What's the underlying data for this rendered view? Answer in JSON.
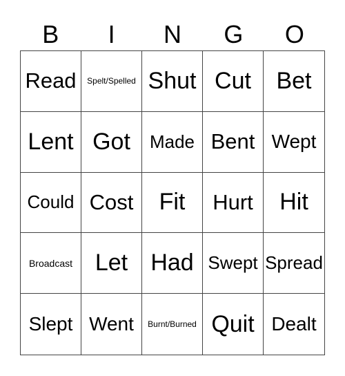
{
  "header": {
    "letters": [
      "B",
      "I",
      "N",
      "G",
      "O"
    ]
  },
  "board": {
    "rows": [
      [
        "Read",
        "Spelt/Spelled",
        "Shut",
        "Cut",
        "Bet"
      ],
      [
        "Lent",
        "Got",
        "Made",
        "Bent",
        "Wept"
      ],
      [
        "Could",
        "Cost",
        "Fit",
        "Hurt",
        "Hit"
      ],
      [
        "Broadcast",
        "Let",
        "Had",
        "Swept",
        "Spread"
      ],
      [
        "Slept",
        "Went",
        "Burnt/Burned",
        "Quit",
        "Dealt"
      ]
    ]
  }
}
